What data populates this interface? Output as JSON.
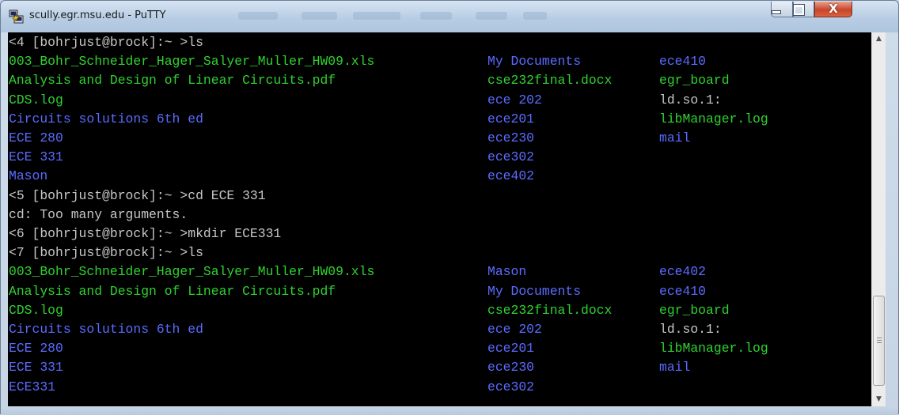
{
  "window": {
    "title": "scully.egr.msu.edu - PuTTY",
    "ghost_tab_labels": [
      "",
      "",
      "",
      "",
      "",
      ""
    ]
  },
  "controls": {
    "minimize": "minimize",
    "maximize": "maximize",
    "close": "X"
  },
  "colors": {
    "terminal_bg": "#000000",
    "prompt_text": "#c7c7c7",
    "file_green": "#2fd22f",
    "dir_blue": "#5a6bff"
  },
  "terminal": {
    "lines": [
      [
        {
          "t": "<4 [bohrjust@brock]:~ >ls",
          "c": "white"
        }
      ],
      [
        {
          "t": "003_Bohr_Schneider_Hager_Salyer_Muller_HW09.xls",
          "c": "green",
          "col": 0
        },
        {
          "t": "My Documents",
          "c": "blue",
          "col": 1
        },
        {
          "t": "ece410",
          "c": "blue",
          "col": 2
        }
      ],
      [
        {
          "t": "Analysis and Design of Linear Circuits.pdf",
          "c": "green",
          "col": 0
        },
        {
          "t": "cse232final.docx",
          "c": "green",
          "col": 1
        },
        {
          "t": "egr_board",
          "c": "green",
          "col": 2
        }
      ],
      [
        {
          "t": "CDS.log",
          "c": "green",
          "col": 0
        },
        {
          "t": "ece 202",
          "c": "blue",
          "col": 1
        },
        {
          "t": "ld.so.1:",
          "c": "white",
          "col": 2
        }
      ],
      [
        {
          "t": "Circuits solutions 6th ed",
          "c": "blue",
          "col": 0
        },
        {
          "t": "ece201",
          "c": "blue",
          "col": 1
        },
        {
          "t": "libManager.log",
          "c": "green",
          "col": 2
        }
      ],
      [
        {
          "t": "ECE 280",
          "c": "blue",
          "col": 0
        },
        {
          "t": "ece230",
          "c": "blue",
          "col": 1
        },
        {
          "t": "mail",
          "c": "blue",
          "col": 2
        }
      ],
      [
        {
          "t": "ECE 331",
          "c": "blue",
          "col": 0
        },
        {
          "t": "ece302",
          "c": "blue",
          "col": 1
        }
      ],
      [
        {
          "t": "Mason",
          "c": "blue",
          "col": 0
        },
        {
          "t": "ece402",
          "c": "blue",
          "col": 1
        }
      ],
      [
        {
          "t": "<5 [bohrjust@brock]:~ >cd ECE 331",
          "c": "white"
        }
      ],
      [
        {
          "t": "cd: Too many arguments.",
          "c": "white"
        }
      ],
      [
        {
          "t": "<6 [bohrjust@brock]:~ >mkdir ECE331",
          "c": "white"
        }
      ],
      [
        {
          "t": "<7 [bohrjust@brock]:~ >ls",
          "c": "white"
        }
      ],
      [
        {
          "t": "003_Bohr_Schneider_Hager_Salyer_Muller_HW09.xls",
          "c": "green",
          "col": 0
        },
        {
          "t": "Mason",
          "c": "blue",
          "col": 1
        },
        {
          "t": "ece402",
          "c": "blue",
          "col": 2
        }
      ],
      [
        {
          "t": "Analysis and Design of Linear Circuits.pdf",
          "c": "green",
          "col": 0
        },
        {
          "t": "My Documents",
          "c": "blue",
          "col": 1
        },
        {
          "t": "ece410",
          "c": "blue",
          "col": 2
        }
      ],
      [
        {
          "t": "CDS.log",
          "c": "green",
          "col": 0
        },
        {
          "t": "cse232final.docx",
          "c": "green",
          "col": 1
        },
        {
          "t": "egr_board",
          "c": "green",
          "col": 2
        }
      ],
      [
        {
          "t": "Circuits solutions 6th ed",
          "c": "blue",
          "col": 0
        },
        {
          "t": "ece 202",
          "c": "blue",
          "col": 1
        },
        {
          "t": "ld.so.1:",
          "c": "white",
          "col": 2
        }
      ],
      [
        {
          "t": "ECE 280",
          "c": "blue",
          "col": 0
        },
        {
          "t": "ece201",
          "c": "blue",
          "col": 1
        },
        {
          "t": "libManager.log",
          "c": "green",
          "col": 2
        }
      ],
      [
        {
          "t": "ECE 331",
          "c": "blue",
          "col": 0
        },
        {
          "t": "ece230",
          "c": "blue",
          "col": 1
        },
        {
          "t": "mail",
          "c": "blue",
          "col": 2
        }
      ],
      [
        {
          "t": "ECE331",
          "c": "blue",
          "col": 0
        },
        {
          "t": "ece302",
          "c": "blue",
          "col": 1
        }
      ]
    ]
  }
}
